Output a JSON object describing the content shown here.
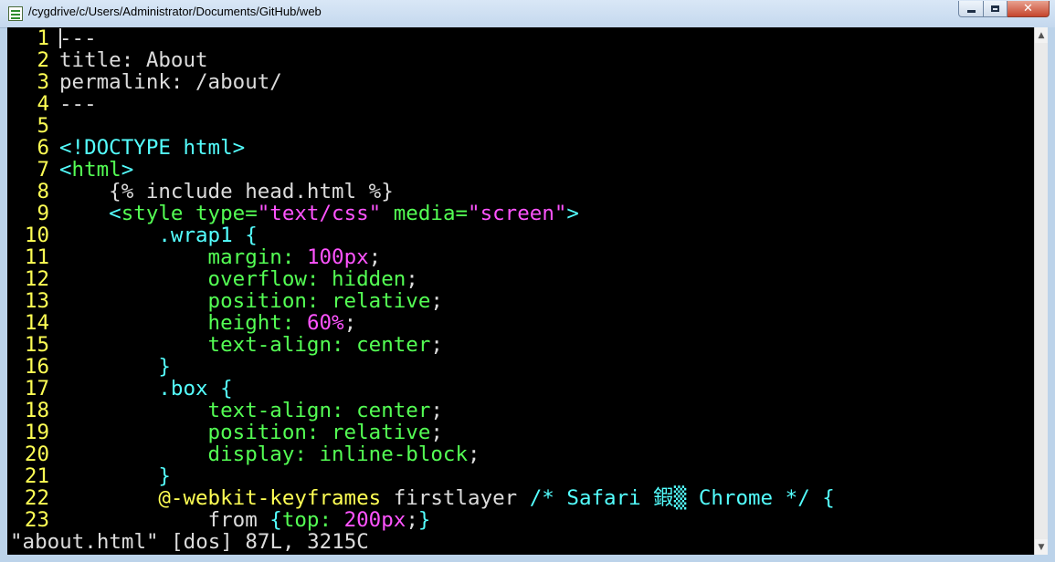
{
  "window": {
    "title": "/cygdrive/c/Users/Administrator/Documents/GitHub/web",
    "buttons": {
      "minimize": "minimize",
      "maximize": "maximize",
      "close": "close"
    }
  },
  "editor": {
    "lines": [
      {
        "num": "1",
        "tokens": [
          {
            "t": "---",
            "c": "txt"
          }
        ]
      },
      {
        "num": "2",
        "tokens": [
          {
            "t": "title: About",
            "c": "txt"
          }
        ]
      },
      {
        "num": "3",
        "tokens": [
          {
            "t": "permalink: /about/",
            "c": "txt"
          }
        ]
      },
      {
        "num": "4",
        "tokens": [
          {
            "t": "---",
            "c": "txt"
          }
        ]
      },
      {
        "num": "5",
        "tokens": []
      },
      {
        "num": "6",
        "tokens": [
          {
            "t": "<!DOCTYPE html>",
            "c": "tag"
          }
        ]
      },
      {
        "num": "7",
        "tokens": [
          {
            "t": "<",
            "c": "tag"
          },
          {
            "t": "html",
            "c": "nm"
          },
          {
            "t": ">",
            "c": "tag"
          }
        ]
      },
      {
        "num": "8",
        "tokens": [
          {
            "t": "    {% include head.html %}",
            "c": "txt"
          }
        ]
      },
      {
        "num": "9",
        "tokens": [
          {
            "t": "    <",
            "c": "tag"
          },
          {
            "t": "style",
            "c": "nm"
          },
          {
            "t": " type=",
            "c": "nm"
          },
          {
            "t": "\"text/css\"",
            "c": "str"
          },
          {
            "t": " media=",
            "c": "nm"
          },
          {
            "t": "\"screen\"",
            "c": "str"
          },
          {
            "t": ">",
            "c": "tag"
          }
        ]
      },
      {
        "num": "10",
        "tokens": [
          {
            "t": "        .wrap1 {",
            "c": "sel"
          }
        ]
      },
      {
        "num": "11",
        "tokens": [
          {
            "t": "            margin: ",
            "c": "prop"
          },
          {
            "t": "100px",
            "c": "num"
          },
          {
            "t": ";",
            "c": "pun"
          }
        ]
      },
      {
        "num": "12",
        "tokens": [
          {
            "t": "            overflow: hidden",
            "c": "prop"
          },
          {
            "t": ";",
            "c": "pun"
          }
        ]
      },
      {
        "num": "13",
        "tokens": [
          {
            "t": "            position: relative",
            "c": "prop"
          },
          {
            "t": ";",
            "c": "pun"
          }
        ]
      },
      {
        "num": "14",
        "tokens": [
          {
            "t": "            height: ",
            "c": "prop"
          },
          {
            "t": "60%",
            "c": "num"
          },
          {
            "t": ";",
            "c": "pun"
          }
        ]
      },
      {
        "num": "15",
        "tokens": [
          {
            "t": "            text-align: center",
            "c": "prop"
          },
          {
            "t": ";",
            "c": "pun"
          }
        ]
      },
      {
        "num": "16",
        "tokens": [
          {
            "t": "        }",
            "c": "sel"
          }
        ]
      },
      {
        "num": "17",
        "tokens": [
          {
            "t": "        .box {",
            "c": "sel"
          }
        ]
      },
      {
        "num": "18",
        "tokens": [
          {
            "t": "            text-align: center",
            "c": "prop"
          },
          {
            "t": ";",
            "c": "pun"
          }
        ]
      },
      {
        "num": "19",
        "tokens": [
          {
            "t": "            position: relative",
            "c": "prop"
          },
          {
            "t": ";",
            "c": "pun"
          }
        ]
      },
      {
        "num": "20",
        "tokens": [
          {
            "t": "            display: inline-block",
            "c": "prop"
          },
          {
            "t": ";",
            "c": "pun"
          }
        ]
      },
      {
        "num": "21",
        "tokens": [
          {
            "t": "        }",
            "c": "sel"
          }
        ]
      },
      {
        "num": "22",
        "tokens": [
          {
            "t": "        @-webkit-keyframes",
            "c": "kw"
          },
          {
            "t": " firstlayer ",
            "c": "txt"
          },
          {
            "t": "/* Safari 鍜▒ Chrome */",
            "c": "cmt"
          },
          {
            "t": " {",
            "c": "sel"
          }
        ]
      },
      {
        "num": "23",
        "tokens": [
          {
            "t": "            from ",
            "c": "txt"
          },
          {
            "t": "{",
            "c": "sel"
          },
          {
            "t": "top: ",
            "c": "prop"
          },
          {
            "t": "200px",
            "c": "num"
          },
          {
            "t": ";",
            "c": "pun"
          },
          {
            "t": "}",
            "c": "sel"
          }
        ]
      }
    ],
    "status": "\"about.html\" [dos] 87L, 3215C"
  },
  "colors": {
    "background": "#000000",
    "line_number": "#ffff54",
    "tag": "#54ffff",
    "attribute": "#54ff54",
    "string": "#ff54ff",
    "text": "#dcdcdc"
  }
}
